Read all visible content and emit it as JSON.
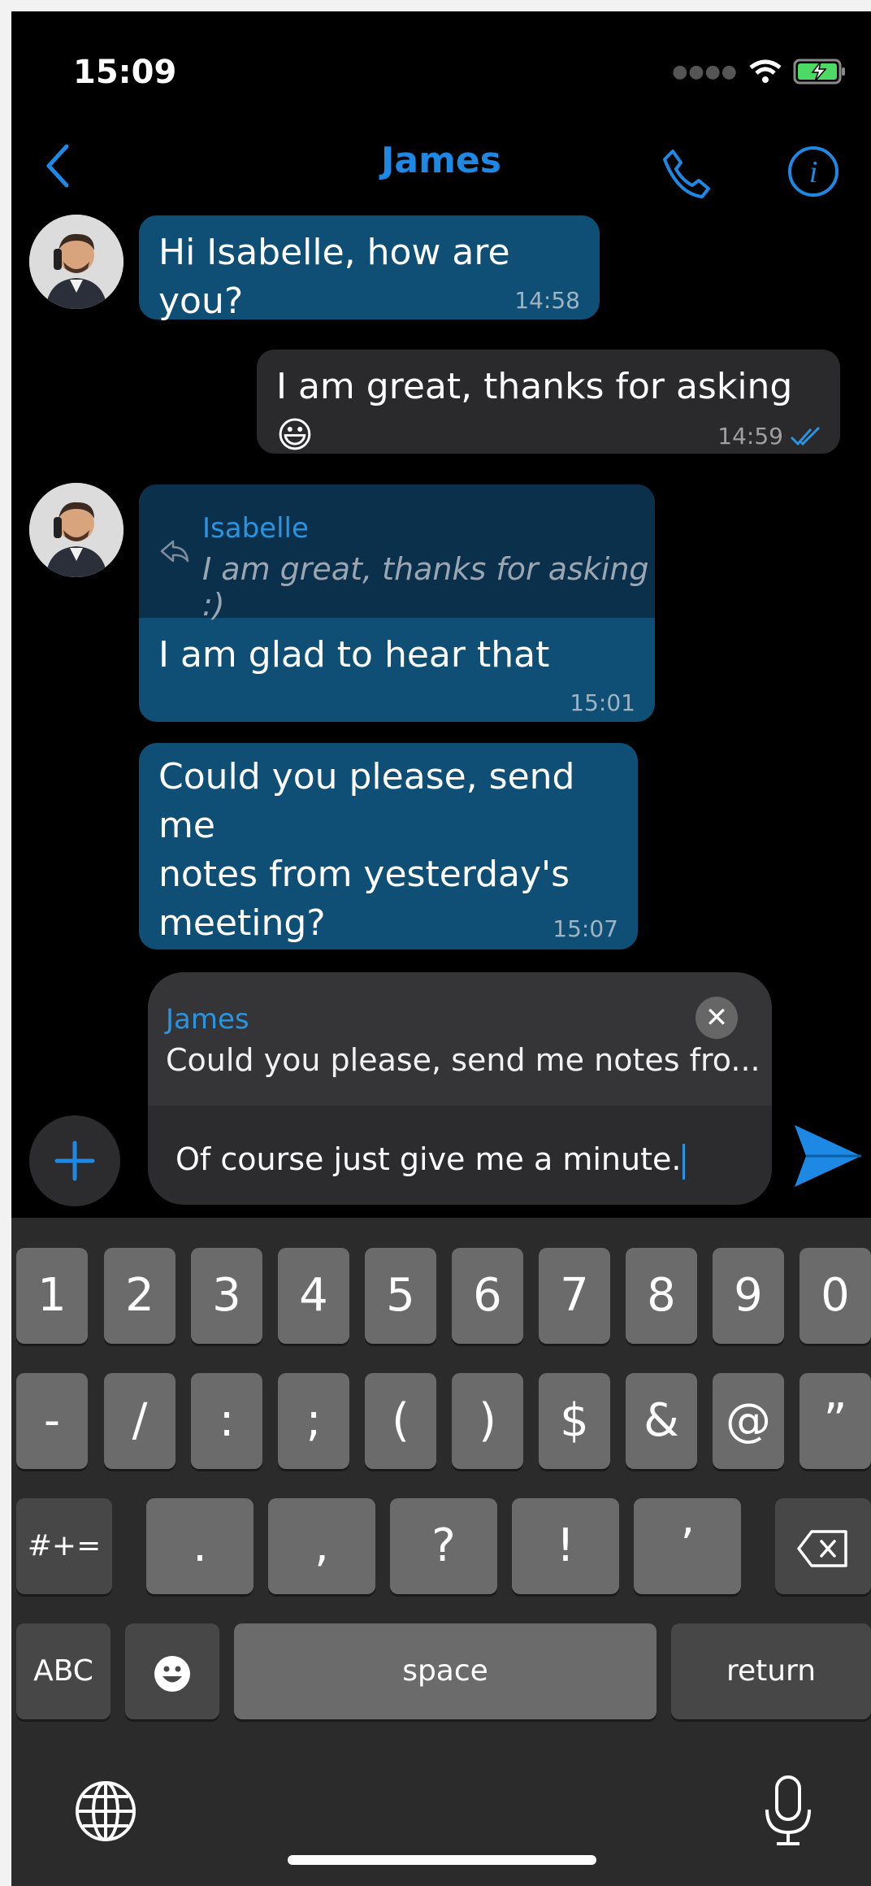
{
  "status": {
    "time": "15:09"
  },
  "nav": {
    "title": "James",
    "back_icon": "chevron-left-icon",
    "call_icon": "phone-icon",
    "info_icon": "info-icon"
  },
  "messages": [
    {
      "direction": "in",
      "text": "Hi Isabelle, how are you?",
      "time": "14:58"
    },
    {
      "direction": "out",
      "text": "I am great, thanks for asking 😃",
      "time": "14:59",
      "status": "read"
    },
    {
      "direction": "in",
      "reply_to": {
        "author": "Isabelle",
        "text": "I am great, thanks for asking :)"
      },
      "text": "I am glad to hear that",
      "time": "15:01"
    },
    {
      "direction": "in",
      "lines": [
        "Could you please, send me",
        "notes from yesterday's",
        "meeting?"
      ],
      "time": "15:07"
    }
  ],
  "composer": {
    "reply_name": "James",
    "reply_text": "Could you please, send me notes fro...",
    "input_value": "Of course just give me a minute.",
    "close_glyph": "✕"
  },
  "keyboard": {
    "row1": [
      "1",
      "2",
      "3",
      "4",
      "5",
      "6",
      "7",
      "8",
      "9",
      "0"
    ],
    "row2": [
      "-",
      "/",
      ":",
      ";",
      "(",
      ")",
      "$",
      "&",
      "@",
      "”"
    ],
    "row3": [
      "#+=",
      ".",
      ",",
      "?",
      "!",
      "’"
    ],
    "row4": [
      "ABC",
      "space",
      "return"
    ]
  },
  "colors": {
    "accent": "#1e88e5",
    "incoming_bubble": "#0f4f76",
    "outgoing_bubble": "#2a2a2c"
  }
}
